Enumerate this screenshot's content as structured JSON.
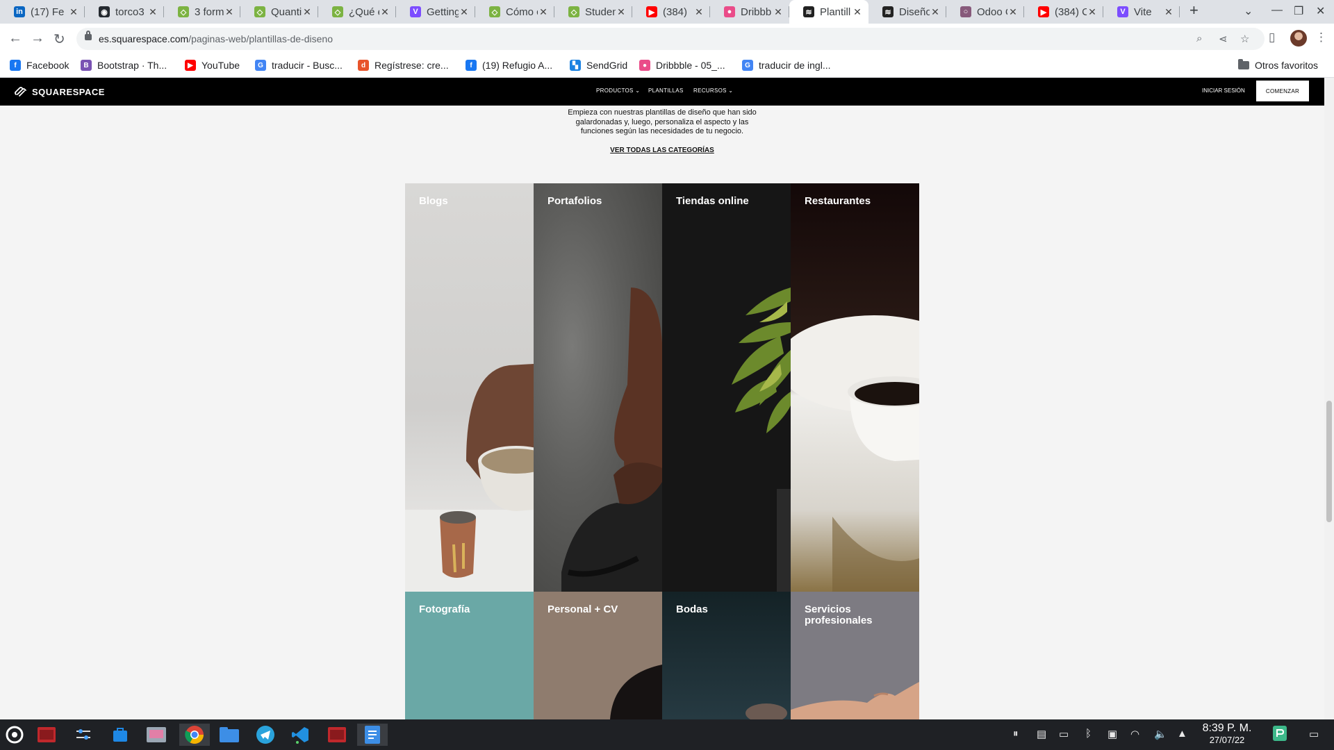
{
  "browser": {
    "tabs": [
      {
        "title": "(17) Fe",
        "color": "#0a66c2",
        "glyph": "in"
      },
      {
        "title": "torco3",
        "color": "#24292f",
        "glyph": "◉"
      },
      {
        "title": "3 form",
        "color": "#7cb342",
        "glyph": "◇"
      },
      {
        "title": "Quanti",
        "color": "#7cb342",
        "glyph": "◇"
      },
      {
        "title": "¿Qué e",
        "color": "#7cb342",
        "glyph": "◇"
      },
      {
        "title": "Getting",
        "color": "#7c4dff",
        "glyph": "V"
      },
      {
        "title": "Cómo c",
        "color": "#7cb342",
        "glyph": "◇"
      },
      {
        "title": "Studen",
        "color": "#7cb342",
        "glyph": "◇"
      },
      {
        "title": "(384)",
        "color": "#ff0000",
        "glyph": "▶"
      },
      {
        "title": "Dribbb",
        "color": "#ea4c89",
        "glyph": "●"
      },
      {
        "title": "Plantill",
        "color": "#222222",
        "glyph": "≋"
      },
      {
        "title": "Diseño",
        "color": "#222222",
        "glyph": "≋"
      },
      {
        "title": "Odoo C",
        "color": "#875a7b",
        "glyph": "○"
      },
      {
        "title": "(384) C",
        "color": "#ff0000",
        "glyph": "▶"
      },
      {
        "title": "Vite",
        "color": "#7c4dff",
        "glyph": "V"
      }
    ],
    "active_tab": 10,
    "url_host": "es.squarespace.com",
    "url_path": "/paginas-web/plantillas-de-diseno",
    "bookmarks": [
      {
        "label": "Facebook",
        "color": "#1877f2",
        "glyph": "f"
      },
      {
        "label": "Bootstrap · Th...",
        "color": "#7952b3",
        "glyph": "B"
      },
      {
        "label": "YouTube",
        "color": "#ff0000",
        "glyph": "▶"
      },
      {
        "label": "traducir - Busc...",
        "color": "#4285f4",
        "glyph": "G"
      },
      {
        "label": "Regístrese: cre...",
        "color": "#e8542a",
        "glyph": "d"
      },
      {
        "label": "(19) Refugio A...",
        "color": "#1877f2",
        "glyph": "f"
      },
      {
        "label": "SendGrid",
        "color": "#1a82e2",
        "glyph": "▚"
      },
      {
        "label": "Dribbble - 05_...",
        "color": "#ea4c89",
        "glyph": "●"
      },
      {
        "label": "traducir de ingl...",
        "color": "#4285f4",
        "glyph": "G"
      }
    ],
    "other_bookmarks": "Otros favoritos"
  },
  "site": {
    "logo": "SQUARESPACE",
    "menu": {
      "products": "PRODUCTOS ⌄",
      "templates": "PLANTILLAS",
      "resources": "RECURSOS ⌄"
    },
    "login": "INICIAR SESIÓN",
    "cta": "COMENZAR",
    "intro": "Empieza con nuestras plantillas de diseño que han sido galardonadas y, luego, personaliza el aspecto y las funciones según las necesidades de tu negocio.",
    "see_all": "VER TODAS LAS CATEGORÍAS",
    "categories": [
      "Blogs",
      "Portafolios",
      "Tiendas online",
      "Restaurantes",
      "Fotografía",
      "Personal + CV",
      "Bodas",
      "Servicios profesionales"
    ]
  },
  "taskbar": {
    "time": "8:39 P. M.",
    "date": "27/07/22"
  }
}
